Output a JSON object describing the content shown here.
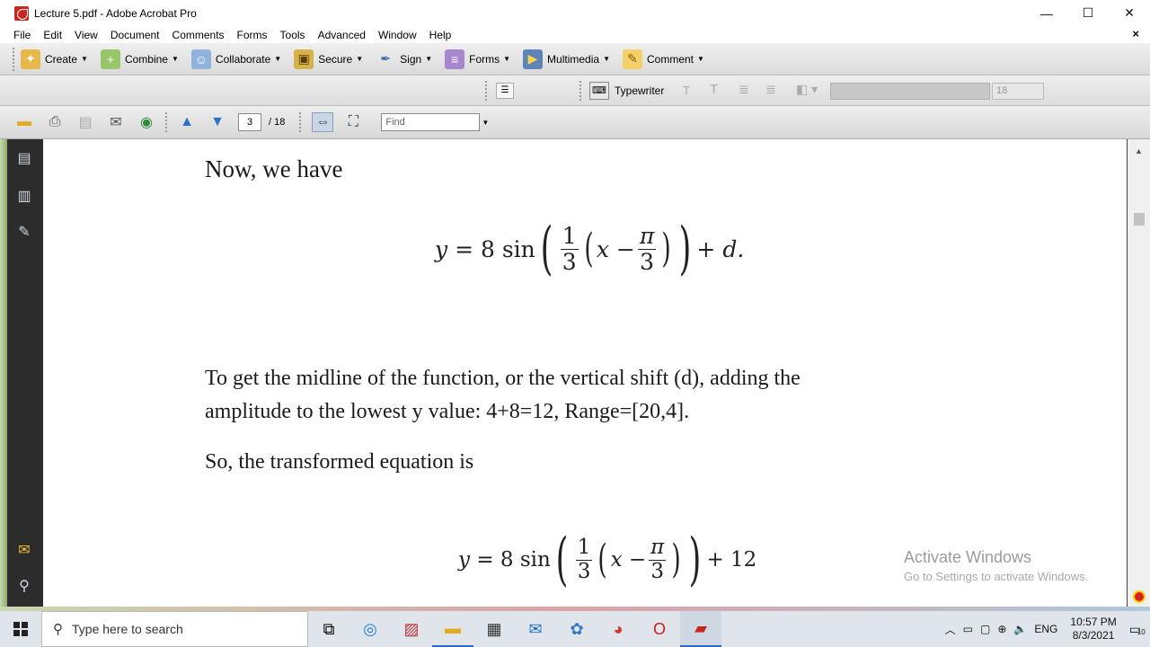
{
  "window": {
    "title": "Lecture 5.pdf - Adobe Acrobat Pro",
    "minimize": "—",
    "maximize": "☐",
    "close": "✕"
  },
  "menu": [
    "File",
    "Edit",
    "View",
    "Document",
    "Comments",
    "Forms",
    "Tools",
    "Advanced",
    "Window",
    "Help"
  ],
  "menu_close": "×",
  "toolbar": {
    "create": "Create",
    "combine": "Combine",
    "collaborate": "Collaborate",
    "secure": "Secure",
    "sign": "Sign",
    "forms": "Forms",
    "multimedia": "Multimedia",
    "comment": "Comment"
  },
  "typewriter_bar": {
    "typewriter": "Typewriter",
    "font_size": "18"
  },
  "nav": {
    "current_page": "3",
    "total": "/ 18",
    "find_placeholder": "Find"
  },
  "doc": {
    "line1": "Now, we have",
    "eq1": {
      "y": "y",
      "eq": "= 8 sin",
      "num": "1",
      "den": "3",
      "x": "x",
      "minus": "−",
      "pi": "π",
      "pi_den": "3",
      "tail": "+",
      "d": "d."
    },
    "para1_l1": "To get the midline of the function, or the vertical shift (d), adding  the",
    "para1_l2": "amplitude to the lowest y value:  4+8=12,  Range=[20,4].",
    "line2": "So, the transformed equation is",
    "eq2": {
      "y": "y",
      "eq": "= 8 sin",
      "num": "1",
      "den": "3",
      "x": "x",
      "minus": "−",
      "pi": "π",
      "pi_den": "3",
      "tail": "+ 12"
    }
  },
  "watermark": {
    "line1": "Activate Windows",
    "line2": "Go to Settings to activate Windows."
  },
  "taskbar": {
    "search_placeholder": "Type here to search",
    "lang": "ENG",
    "time": "10:57 PM",
    "date": "8/3/2021",
    "notif_count": "10"
  }
}
